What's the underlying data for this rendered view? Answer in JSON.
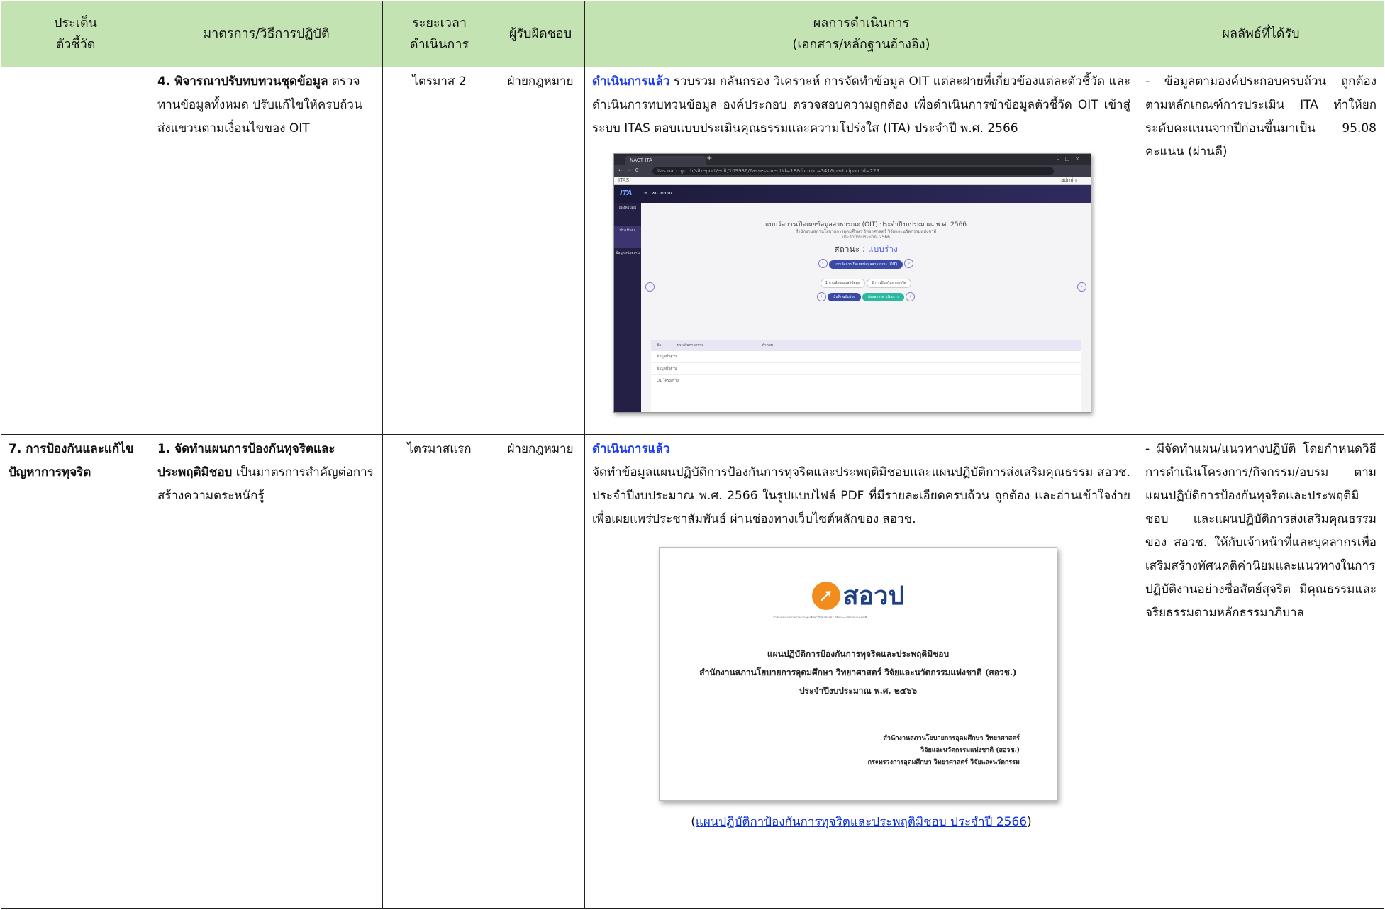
{
  "headers": {
    "issue": [
      "ประเด็น",
      "ตัวชี้วัด"
    ],
    "measures": "มาตรการ/วิธีการปฏิบัติ",
    "period": [
      "ระยะเวลา",
      "ดำเนินการ"
    ],
    "owner": "ผู้รับผิดชอบ",
    "results": [
      "ผลการดำเนินการ",
      "(เอกสาร/หลักฐานอ้างอิง)"
    ],
    "outcome": "ผลลัพธ์ที่ได้รับ"
  },
  "rows": [
    {
      "issue": "",
      "measure_title": "4. พิจารณาปรับทบทวนชุดข้อมูล",
      "measure_text": "ตรวจทานข้อมูลทั้งหมด ปรับแก้ไขให้ครบถ้วน ส่งแขวนตามเงื่อนไขของ OIT",
      "period": "ไตรมาส 2",
      "owner": "ฝ่ายกฎหมาย",
      "status": "ดำเนินการแล้ว",
      "result_text": " รวบรวม กลั่นกรอง วิเคราะห์ การจัดทำข้อมูล OIT แต่ละฝ่ายที่เกี่ยวข้องแต่ละตัวชี้วัด และดำเนินการทบทวนข้อมูล องค์ประกอบ ตรวจสอบความถูกต้อง เพื่อดำเนินการขำข้อมูลตัวชี้วัด OIT เข้าสู่ระบบ ITAS ตอบแบบประเมินคุณธรรมและความโปร่งใส (ITA) ประจำปี พ.ศ. 2566",
      "outcome": "- ข้อมูลตามองค์ประกอบครบถ้วน ถูกต้องตามหลักเกณฑ์การประเมิน ITA ทำให้ยกระดับคะแนนจากปีก่อนขึ้นมาเป็น 95.08 คะแนน (ผ่านดี)"
    },
    {
      "issue": "7. การป้องกันและแก้ไขปัญหาการทุจริต",
      "measure_title": "1. จัดทำแผนการป้องกันทุจริตและประพฤติมิชอบ",
      "measure_text": " เป็นมาตรการสำคัญต่อการสร้างความตระหนักรู้",
      "period": "ไตรมาสแรก",
      "owner": "ฝ่ายกฎหมาย",
      "status": "ดำเนินการแล้ว",
      "result_text": "จัดทำข้อมูลแผนปฏิบัติการป้องกันการทุจริตและประพฤติมิชอบและแผนปฏิบัติการส่งเสริมคุณธรรม สอวช. ประจำปีงบประมาณ พ.ศ. 2566 ในรูปแบบไฟล์ PDF ที่มีรายละเอียดครบถ้วน ถูกต้อง และอ่านเข้าใจง่าย เพื่อเผยแพร่ประชาสัมพันธ์ ผ่านช่องทางเว็บไซต์หลักของ สอวช.",
      "caption_open": "(",
      "caption_link": "แผนปฏิบัติกาป้องกันการทุจริตและประพฤติมิชอบ ประจำปี 2566",
      "caption_close": ")",
      "outcome": "- มีจัดทำแผน/แนวทางปฏิบัติ โดยกำหนดวิธีการดำเนินโครงการ/กิจกรรม/อบรม ตามแผนปฏิบัติการป้องกันทุจริตและประพฤติมิชอบ และแผนปฏิบัติการส่งเสริมคุณธรรมของ สอวช. ให้กับเจ้าหน้าที่และบุคลากรเพื่อเสริมสร้างทัศนคติค่านิยมและแนวทางในการปฏิบัติงานอย่างซื่อสัตย์สุจริต มีคุณธรรมและจริยธรรมตามหลักธรรมาภิบาล"
    }
  ],
  "screenshot": {
    "tab": "NACT ITA",
    "url": "itas.nacc.go.th/sitreport/edit/109936/?assessmentId=18&formId=341&participantId=229",
    "bookmark": "ITAS",
    "user": "admin",
    "logo": "ITA",
    "menu": "หน่วยงาน",
    "side_items": [
      "แผงควบคุม",
      "ประเมินผล",
      "ข้อมูลหน่วยงาน"
    ],
    "form_title": "แบบวัดการเปิดเผยข้อมูลสาธารณะ (OIT) ประจำปีงบประมาณ พ.ศ. 2566",
    "form_org": "สำนักงานสภานโยบายการอุดมศึกษา วิทยาศาสตร์ วิจัยและนวัตกรรมแห่งชาติ",
    "form_year": "ประจำปีงบประมาณ 2566",
    "status_label": "สถานะ :",
    "status_value": "แบบร่าง",
    "form_pill": "แบบวัดการเปิดเผยข้อมูลสาธารณะ (OIT)",
    "step1": "1 การนำเผยแพร่ข้อมูล",
    "step2": "2 การป้องกันการทุจริต",
    "save_label": "บันทึกฉบับร่าง",
    "submit_label": "ส่งผลการดำเนินการ",
    "table_head": [
      "ข้อ",
      "ประเด็นการตรวจ",
      "คำตอบ"
    ],
    "table_rows": [
      "ข้อมูลพื้นฐาน",
      "ข้อมูลพื้นฐาน",
      "O1 โครงสร้าง"
    ]
  },
  "cover": {
    "brand": "สอวป",
    "brand_sub": "สำนักงานสภานโยบายการอุดมศึกษา วิทยาศาสตร์ วิจัยและนวัตกรรมแห่งชาติ",
    "title1": "แผนปฏิบัติการป้องกันการทุจริตและประพฤติมิชอบ",
    "title2": "สำนักงานสภานโยบายการอุดมศึกษา วิทยาศาสตร์ วิจัยและนวัตกรรมแห่งชาติ (สอวช.)",
    "title3": "ประจำปีงบประมาณ พ.ศ. ๒๕๖๖",
    "foot1": "สำนักงานสภานโยบายการอุดมศึกษา วิทยาศาสตร์",
    "foot2": "วิจัยและนวัตกรรมแห่งชาติ (สอวช.)",
    "foot3": "กระทรวงการอุดมศึกษา วิทยาศาสตร์ วิจัยและนวัตกรรม"
  }
}
